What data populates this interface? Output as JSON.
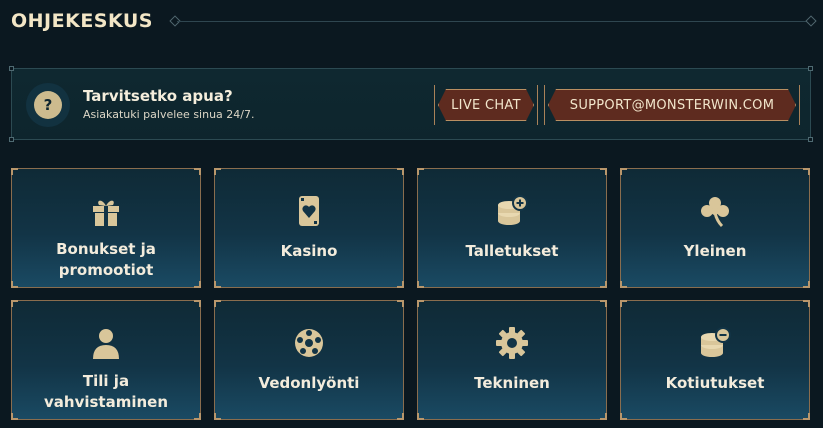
{
  "header": {
    "title": "OHJEKESKUS"
  },
  "help": {
    "title": "Tarvitsetko apua?",
    "subtitle": "Asiakatuki palvelee sinua 24/7.",
    "icon": "question-icon",
    "live_chat_label": "LIVE CHAT",
    "support_label": "SUPPORT@MONSTERWIN.COM"
  },
  "categories": [
    {
      "label": "Bonukset ja promootiot",
      "icon": "gift-icon"
    },
    {
      "label": "Kasino",
      "icon": "playing-card-icon"
    },
    {
      "label": "Talletukset",
      "icon": "coins-plus-icon"
    },
    {
      "label": "Yleinen",
      "icon": "clover-icon"
    },
    {
      "label": "Tili ja vahvistaminen",
      "icon": "user-icon"
    },
    {
      "label": "Vedonlyönti",
      "icon": "soccer-ball-icon"
    },
    {
      "label": "Tekninen",
      "icon": "gear-icon"
    },
    {
      "label": "Kotiutukset",
      "icon": "coins-minus-icon"
    }
  ],
  "colors": {
    "background": "#0b1820",
    "gold": "#cdbb8e",
    "button_fill": "#5e2b1f",
    "button_border": "#b98f62"
  }
}
